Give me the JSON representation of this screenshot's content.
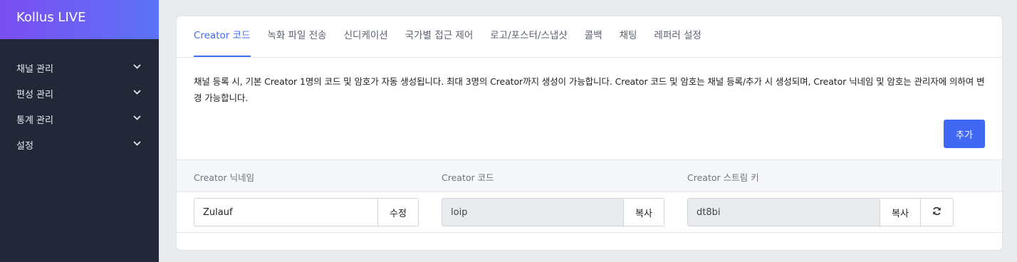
{
  "sidebar": {
    "brand": "Kollus LIVE",
    "items": [
      {
        "label": "채널 관리",
        "icon": "chevron-down-icon"
      },
      {
        "label": "편성 관리",
        "icon": "chevron-down-icon"
      },
      {
        "label": "통계 관리",
        "icon": "chevron-down-icon"
      },
      {
        "label": "설정",
        "icon": "chevron-down-icon"
      }
    ]
  },
  "tabs": [
    {
      "label": "Creator 코드",
      "active": true
    },
    {
      "label": "녹화 파일 전송"
    },
    {
      "label": "신디케이션"
    },
    {
      "label": "국가별 접근 제어"
    },
    {
      "label": "로고/포스터/스냅샷"
    },
    {
      "label": "콜백"
    },
    {
      "label": "채팅"
    },
    {
      "label": "레퍼러 설정"
    }
  ],
  "description": "채널 등록 시, 기본 Creator 1명의 코드 및 암호가 자동 생성됩니다. 최대 3명의 Creator까지 생성이 가능합니다. Creator 코드 및 암호는 채널 등록/추가 시 생성되며, Creator 닉네임 및 암호는 관리자에 의하여 변경 가능합니다.",
  "add_button": "추가",
  "table": {
    "headers": [
      "Creator 닉네임",
      "Creator 코드",
      "Creator 스트림 키"
    ],
    "row": {
      "nickname": "Zulauf",
      "edit_button": "수정",
      "code": "loip",
      "copy_code_button": "복사",
      "stream_key": "dt8bi",
      "copy_key_button": "복사",
      "refresh_icon": "refresh-icon"
    }
  },
  "colors": {
    "accent": "#4168f3",
    "sidebar_bg": "#222838",
    "brand_gradient_start": "#7b4ef2",
    "brand_gradient_end": "#5b73f5"
  }
}
